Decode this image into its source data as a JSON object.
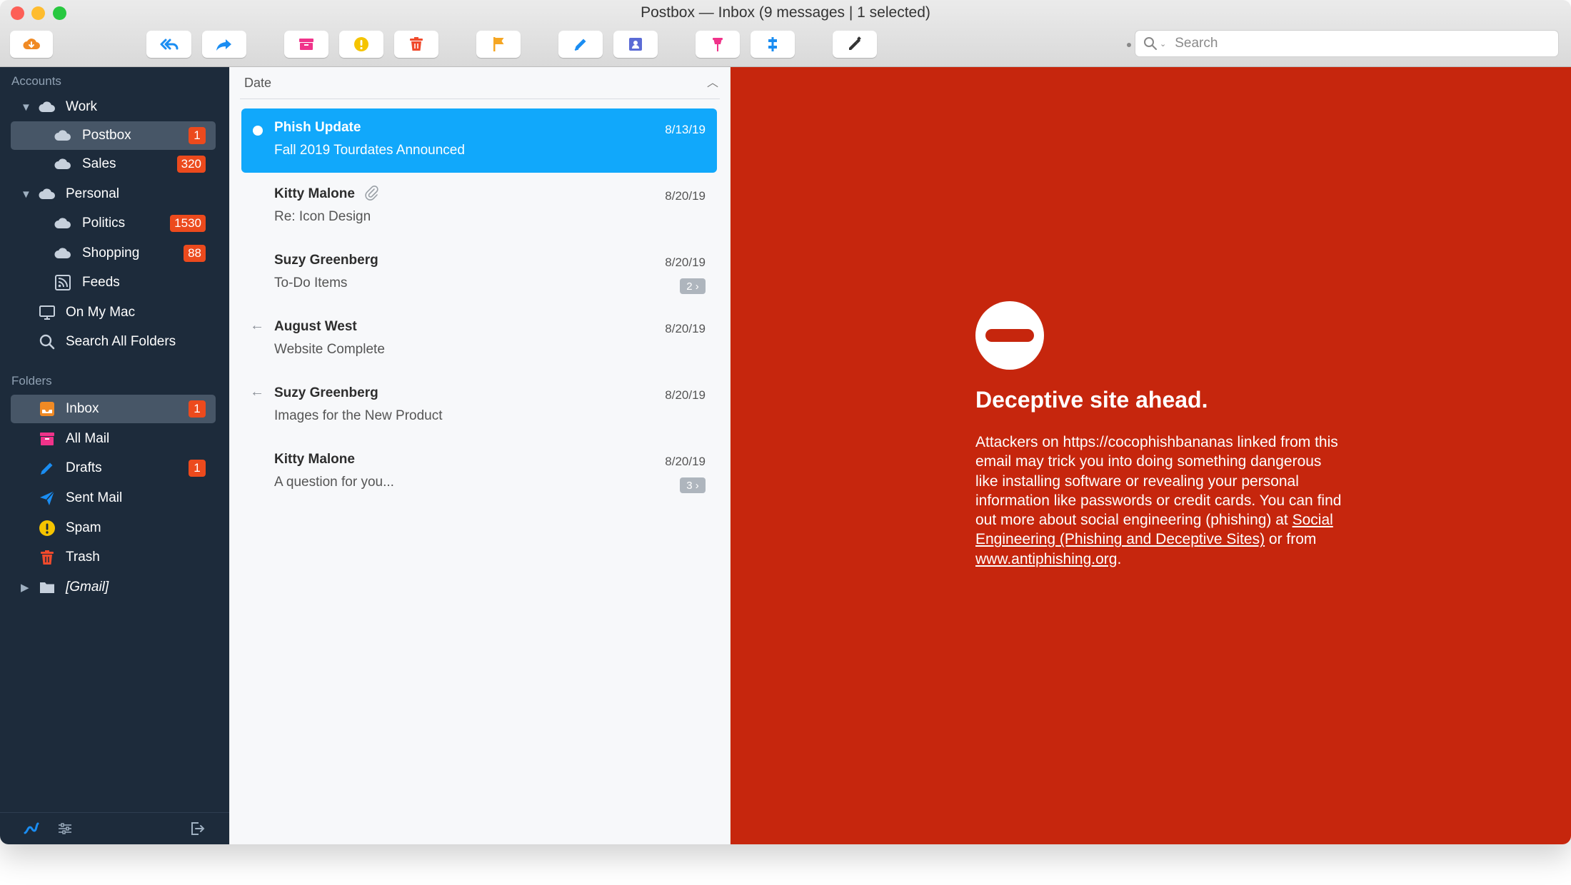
{
  "window": {
    "title": "Postbox — Inbox (9 messages | 1 selected)"
  },
  "toolbar": {
    "buttons": [
      {
        "name": "get-mail",
        "icon": "cloud-download-icon",
        "color": "#f08a24"
      },
      {
        "name": "reply-all",
        "icon": "reply-all-icon",
        "color": "#1a8df2"
      },
      {
        "name": "forward",
        "icon": "forward-icon",
        "color": "#1a8df2"
      },
      {
        "name": "archive",
        "icon": "archive-icon",
        "color": "#f0338a"
      },
      {
        "name": "spam",
        "icon": "exclamation-icon",
        "color": "#f5c400"
      },
      {
        "name": "delete",
        "icon": "trash-icon",
        "color": "#f04a2c"
      },
      {
        "name": "flag",
        "icon": "flag-icon",
        "color": "#f5a623"
      },
      {
        "name": "compose",
        "icon": "pencil-icon",
        "color": "#1a8df2"
      },
      {
        "name": "contacts",
        "icon": "address-book-icon",
        "color": "#5b6bd6"
      },
      {
        "name": "tag",
        "icon": "pin-icon",
        "color": "#f0338a"
      },
      {
        "name": "move",
        "icon": "move-icon",
        "color": "#1a8df2"
      },
      {
        "name": "customize",
        "icon": "tools-icon",
        "color": "#333333"
      }
    ],
    "search": {
      "placeholder": "Search",
      "value": ""
    }
  },
  "sidebar": {
    "accounts_header": "Accounts",
    "accounts": [
      {
        "label": "Work",
        "level": 0,
        "expanded": true,
        "icon": "cloud-icon"
      },
      {
        "label": "Postbox",
        "level": 1,
        "badge": "1",
        "selected": true,
        "icon": "cloud-icon"
      },
      {
        "label": "Sales",
        "level": 1,
        "badge": "320",
        "icon": "cloud-icon"
      },
      {
        "label": "Personal",
        "level": 0,
        "expanded": true,
        "icon": "cloud-icon"
      },
      {
        "label": "Politics",
        "level": 1,
        "badge": "1530",
        "icon": "cloud-icon"
      },
      {
        "label": "Shopping",
        "level": 1,
        "badge": "88",
        "icon": "cloud-icon"
      },
      {
        "label": "Feeds",
        "level": 1,
        "icon": "rss-icon"
      },
      {
        "label": "On My Mac",
        "level": 0,
        "icon": "monitor-icon"
      },
      {
        "label": "Search All Folders",
        "level": 0,
        "icon": "search-icon"
      }
    ],
    "folders_header": "Folders",
    "folders": [
      {
        "label": "Inbox",
        "badge": "1",
        "selected": true,
        "icon": "inbox-icon",
        "color": "#f08a24"
      },
      {
        "label": "All Mail",
        "icon": "archive-icon",
        "color": "#f0338a"
      },
      {
        "label": "Drafts",
        "badge": "1",
        "icon": "pencil-icon",
        "color": "#1a8df2"
      },
      {
        "label": "Sent Mail",
        "icon": "paper-plane-icon",
        "color": "#1a8df2"
      },
      {
        "label": "Spam",
        "icon": "exclamation-icon",
        "color": "#f5c400"
      },
      {
        "label": "Trash",
        "icon": "trash-icon",
        "color": "#f04a2c"
      },
      {
        "label": "[Gmail]",
        "icon": "folder-icon",
        "collapsed": true,
        "italic": true
      }
    ]
  },
  "message_list": {
    "sort_label": "Date",
    "messages": [
      {
        "sender": "Phish Update",
        "subject": "Fall 2019 Tourdates Announced",
        "date": "8/13/19",
        "selected": true,
        "unread": true
      },
      {
        "sender": "Kitty Malone",
        "subject": "Re: Icon Design",
        "date": "8/20/19",
        "attachment": true
      },
      {
        "sender": "Suzy Greenberg",
        "subject": "To-Do Items",
        "date": "8/20/19",
        "thread": "2 ›"
      },
      {
        "sender": "August West",
        "subject": "Website Complete",
        "date": "8/20/19",
        "replied": true
      },
      {
        "sender": "Suzy Greenberg",
        "subject": "Images for the New Product",
        "date": "8/20/19",
        "replied": true
      },
      {
        "sender": "Kitty Malone",
        "subject": "A question for you...",
        "date": "8/20/19",
        "thread": "3 ›"
      }
    ]
  },
  "warning": {
    "title": "Deceptive site ahead.",
    "body_1": "Attackers on https://cocophishbananas linked from this email may trick you into doing something dangerous like installing software or revealing your personal information like passwords or credit cards. You can find out more about social engineering (phishing) at ",
    "link_1": "Social Engineering (Phishing and Deceptive Sites)",
    "body_2": " or from ",
    "link_2": "www.antiphishing.org",
    "body_3": ".",
    "background": "#c6260d"
  }
}
